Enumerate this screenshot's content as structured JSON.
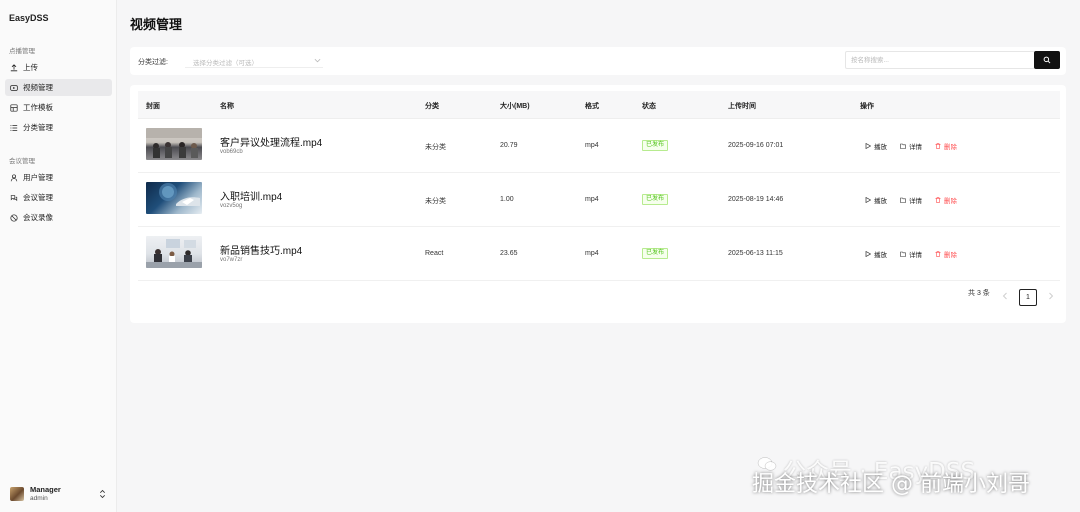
{
  "brand": "EasyDSS",
  "sidebar": {
    "groups": [
      {
        "label": "点播管理",
        "items": [
          {
            "label": "上传",
            "icon": "upload-icon"
          },
          {
            "label": "视频管理",
            "icon": "video-icon",
            "active": true
          },
          {
            "label": "工作模板",
            "icon": "template-icon"
          },
          {
            "label": "分类管理",
            "icon": "list-icon"
          }
        ]
      },
      {
        "label": "会议管理",
        "items": [
          {
            "label": "用户管理",
            "icon": "user-icon"
          },
          {
            "label": "会议管理",
            "icon": "meeting-icon"
          },
          {
            "label": "会议录像",
            "icon": "record-icon"
          }
        ]
      }
    ],
    "user": {
      "name": "Manager",
      "role": "admin"
    }
  },
  "page_title": "视频管理",
  "filter": {
    "label": "分类过滤:",
    "select_placeholder": "选择分类过滤（可选）",
    "search_placeholder": "按名称搜索..."
  },
  "table": {
    "headers": [
      "封面",
      "名称",
      "分类",
      "大小(MB)",
      "格式",
      "状态",
      "上传时间",
      "操作"
    ],
    "rows": [
      {
        "name": "客户异议处理流程.mp4",
        "code": "vob69cb",
        "category": "未分类",
        "size": "20.79",
        "format": "mp4",
        "status": "已发布",
        "time": "2025-09-16 07:01"
      },
      {
        "name": "入职培训.mp4",
        "code": "vozv5og",
        "category": "未分类",
        "size": "1.00",
        "format": "mp4",
        "status": "已发布",
        "time": "2025-08-19 14:46"
      },
      {
        "name": "新品销售技巧.mp4",
        "code": "vo7w7zr",
        "category": "React",
        "size": "23.65",
        "format": "mp4",
        "status": "已发布",
        "time": "2025-06-13 11:15"
      }
    ],
    "actions": {
      "play": "播放",
      "detail": "详情",
      "delete": "删除"
    }
  },
  "pagination": {
    "total_text": "共 3 条",
    "current_page": "1"
  },
  "watermark": {
    "line1": "公众号 · EasyDSS",
    "line2": "掘金技术社区 @ 前端小刘哥"
  },
  "colors": {
    "accent": "#111111",
    "success": "#52c41a",
    "danger": "#ff4d4f"
  }
}
